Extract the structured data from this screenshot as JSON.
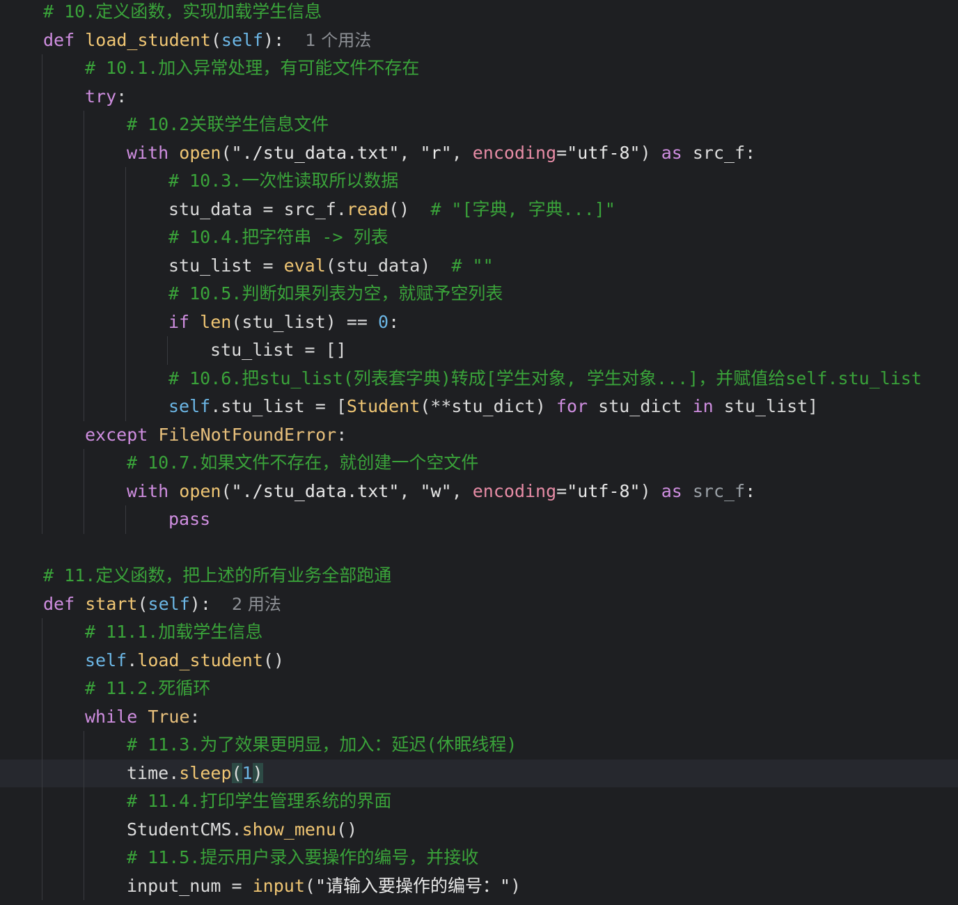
{
  "editor": {
    "colors": {
      "background": "#1e1f22",
      "keyword": "#cf8ee0",
      "function": "#f0c674",
      "self": "#6cb7e6",
      "comment": "#3aa33a",
      "param": "#e78ca6",
      "current_line": "#26282e"
    },
    "current_line_index": 27,
    "lines": [
      {
        "indent": 1,
        "tokens": [
          {
            "c": "cm",
            "t": "# 10.定义函数，实现加载学生信息"
          }
        ]
      },
      {
        "indent": 1,
        "tokens": [
          {
            "c": "kw",
            "t": "def "
          },
          {
            "c": "fn",
            "t": "load_student"
          },
          {
            "c": "plain",
            "t": "("
          },
          {
            "c": "self",
            "t": "self"
          },
          {
            "c": "plain",
            "t": "):  "
          },
          {
            "c": "hint",
            "t": "1 个用法"
          }
        ]
      },
      {
        "indent": 2,
        "tokens": [
          {
            "c": "cm",
            "t": "# 10.1.加入异常处理，有可能文件不存在"
          }
        ]
      },
      {
        "indent": 2,
        "tokens": [
          {
            "c": "kw",
            "t": "try"
          },
          {
            "c": "plain",
            "t": ":"
          }
        ]
      },
      {
        "indent": 3,
        "tokens": [
          {
            "c": "cm",
            "t": "# 10.2关联学生信息文件"
          }
        ]
      },
      {
        "indent": 3,
        "tokens": [
          {
            "c": "kw",
            "t": "with "
          },
          {
            "c": "bi",
            "t": "open"
          },
          {
            "c": "plain",
            "t": "("
          },
          {
            "c": "str",
            "t": "\"./stu_data.txt\""
          },
          {
            "c": "plain",
            "t": ", "
          },
          {
            "c": "str",
            "t": "\"r\""
          },
          {
            "c": "plain",
            "t": ", "
          },
          {
            "c": "param",
            "t": "encoding"
          },
          {
            "c": "plain",
            "t": "="
          },
          {
            "c": "str",
            "t": "\"utf-8\""
          },
          {
            "c": "plain",
            "t": ") "
          },
          {
            "c": "kw",
            "t": "as "
          },
          {
            "c": "plain",
            "t": "src_f:"
          }
        ]
      },
      {
        "indent": 4,
        "tokens": [
          {
            "c": "cm",
            "t": "# 10.3.一次性读取所以数据"
          }
        ]
      },
      {
        "indent": 4,
        "tokens": [
          {
            "c": "plain",
            "t": "stu_data = src_f."
          },
          {
            "c": "fn",
            "t": "read"
          },
          {
            "c": "plain",
            "t": "()  "
          },
          {
            "c": "cm",
            "t": "# \"[字典, 字典...]\""
          }
        ]
      },
      {
        "indent": 4,
        "tokens": [
          {
            "c": "cm",
            "t": "# 10.4.把字符串 -> 列表"
          }
        ]
      },
      {
        "indent": 4,
        "tokens": [
          {
            "c": "plain",
            "t": "stu_list = "
          },
          {
            "c": "bi",
            "t": "eval"
          },
          {
            "c": "plain",
            "t": "(stu_data)  "
          },
          {
            "c": "cm",
            "t": "# \"\""
          }
        ]
      },
      {
        "indent": 4,
        "tokens": [
          {
            "c": "cm",
            "t": "# 10.5.判断如果列表为空，就赋予空列表"
          }
        ]
      },
      {
        "indent": 4,
        "tokens": [
          {
            "c": "kw",
            "t": "if "
          },
          {
            "c": "bi",
            "t": "len"
          },
          {
            "c": "plain",
            "t": "(stu_list) == "
          },
          {
            "c": "num",
            "t": "0"
          },
          {
            "c": "plain",
            "t": ":"
          }
        ]
      },
      {
        "indent": 5,
        "tokens": [
          {
            "c": "plain",
            "t": "stu_list = []"
          }
        ]
      },
      {
        "indent": 4,
        "tokens": [
          {
            "c": "cm",
            "t": "# 10.6.把stu_list(列表套字典)转成[学生对象, 学生对象...]，并赋值给self.stu_list"
          }
        ]
      },
      {
        "indent": 4,
        "tokens": [
          {
            "c": "self",
            "t": "self"
          },
          {
            "c": "plain",
            "t": ".stu_list = ["
          },
          {
            "c": "fn",
            "t": "Student"
          },
          {
            "c": "plain",
            "t": "(**stu_dict) "
          },
          {
            "c": "kw",
            "t": "for "
          },
          {
            "c": "plain",
            "t": "stu_dict "
          },
          {
            "c": "kw",
            "t": "in "
          },
          {
            "c": "plain",
            "t": "stu_list]"
          }
        ]
      },
      {
        "indent": 2,
        "tokens": [
          {
            "c": "kw",
            "t": "except "
          },
          {
            "c": "cls",
            "t": "FileNotFoundError"
          },
          {
            "c": "plain",
            "t": ":"
          }
        ]
      },
      {
        "indent": 3,
        "tokens": [
          {
            "c": "cm",
            "t": "# 10.7.如果文件不存在，就创建一个空文件"
          }
        ]
      },
      {
        "indent": 3,
        "tokens": [
          {
            "c": "kw",
            "t": "with "
          },
          {
            "c": "bi",
            "t": "open"
          },
          {
            "c": "plain",
            "t": "("
          },
          {
            "c": "str",
            "t": "\"./stu_data.txt\""
          },
          {
            "c": "plain",
            "t": ", "
          },
          {
            "c": "str",
            "t": "\"w\""
          },
          {
            "c": "plain",
            "t": ", "
          },
          {
            "c": "param",
            "t": "encoding"
          },
          {
            "c": "plain",
            "t": "="
          },
          {
            "c": "str",
            "t": "\"utf-8\""
          },
          {
            "c": "plain",
            "t": ") "
          },
          {
            "c": "kw",
            "t": "as "
          },
          {
            "c": "dim",
            "t": "src_f"
          },
          {
            "c": "plain",
            "t": ":"
          }
        ]
      },
      {
        "indent": 4,
        "tokens": [
          {
            "c": "kw",
            "t": "pass"
          }
        ]
      },
      {
        "indent": 0,
        "tokens": []
      },
      {
        "indent": 1,
        "tokens": [
          {
            "c": "cm",
            "t": "# 11.定义函数，把上述的所有业务全部跑通"
          }
        ]
      },
      {
        "indent": 1,
        "tokens": [
          {
            "c": "kw",
            "t": "def "
          },
          {
            "c": "fn",
            "t": "start"
          },
          {
            "c": "plain",
            "t": "("
          },
          {
            "c": "self",
            "t": "self"
          },
          {
            "c": "plain",
            "t": "):  "
          },
          {
            "c": "hint",
            "t": "2 用法"
          }
        ]
      },
      {
        "indent": 2,
        "tokens": [
          {
            "c": "cm",
            "t": "# 11.1.加载学生信息"
          }
        ]
      },
      {
        "indent": 2,
        "tokens": [
          {
            "c": "self",
            "t": "self"
          },
          {
            "c": "plain",
            "t": "."
          },
          {
            "c": "fn",
            "t": "load_student"
          },
          {
            "c": "plain",
            "t": "()"
          }
        ]
      },
      {
        "indent": 2,
        "tokens": [
          {
            "c": "cm",
            "t": "# 11.2.死循环"
          }
        ]
      },
      {
        "indent": 2,
        "tokens": [
          {
            "c": "kw",
            "t": "while "
          },
          {
            "c": "cls",
            "t": "True"
          },
          {
            "c": "plain",
            "t": ":"
          }
        ]
      },
      {
        "indent": 3,
        "tokens": [
          {
            "c": "cm",
            "t": "# 11.3.为了效果更明显，加入：延迟(休眠线程)"
          }
        ]
      },
      {
        "indent": 3,
        "tokens": [
          {
            "c": "plain",
            "t": "time."
          },
          {
            "c": "fn",
            "t": "sleep"
          },
          {
            "c": "brace",
            "t": "("
          },
          {
            "c": "num",
            "t": "1"
          },
          {
            "c": "brace",
            "t": ")"
          }
        ]
      },
      {
        "indent": 3,
        "tokens": [
          {
            "c": "cm",
            "t": "# 11.4.打印学生管理系统的界面"
          }
        ]
      },
      {
        "indent": 3,
        "tokens": [
          {
            "c": "plain",
            "t": "StudentCMS."
          },
          {
            "c": "fn",
            "t": "show_menu"
          },
          {
            "c": "plain",
            "t": "()"
          }
        ]
      },
      {
        "indent": 3,
        "tokens": [
          {
            "c": "cm",
            "t": "# 11.5.提示用户录入要操作的编号，并接收"
          }
        ]
      },
      {
        "indent": 3,
        "tokens": [
          {
            "c": "plain",
            "t": "input_num = "
          },
          {
            "c": "bi",
            "t": "input"
          },
          {
            "c": "plain",
            "t": "("
          },
          {
            "c": "str",
            "t": "\"请输入要操作的编号：\""
          },
          {
            "c": "plain",
            "t": ")"
          }
        ]
      }
    ]
  }
}
